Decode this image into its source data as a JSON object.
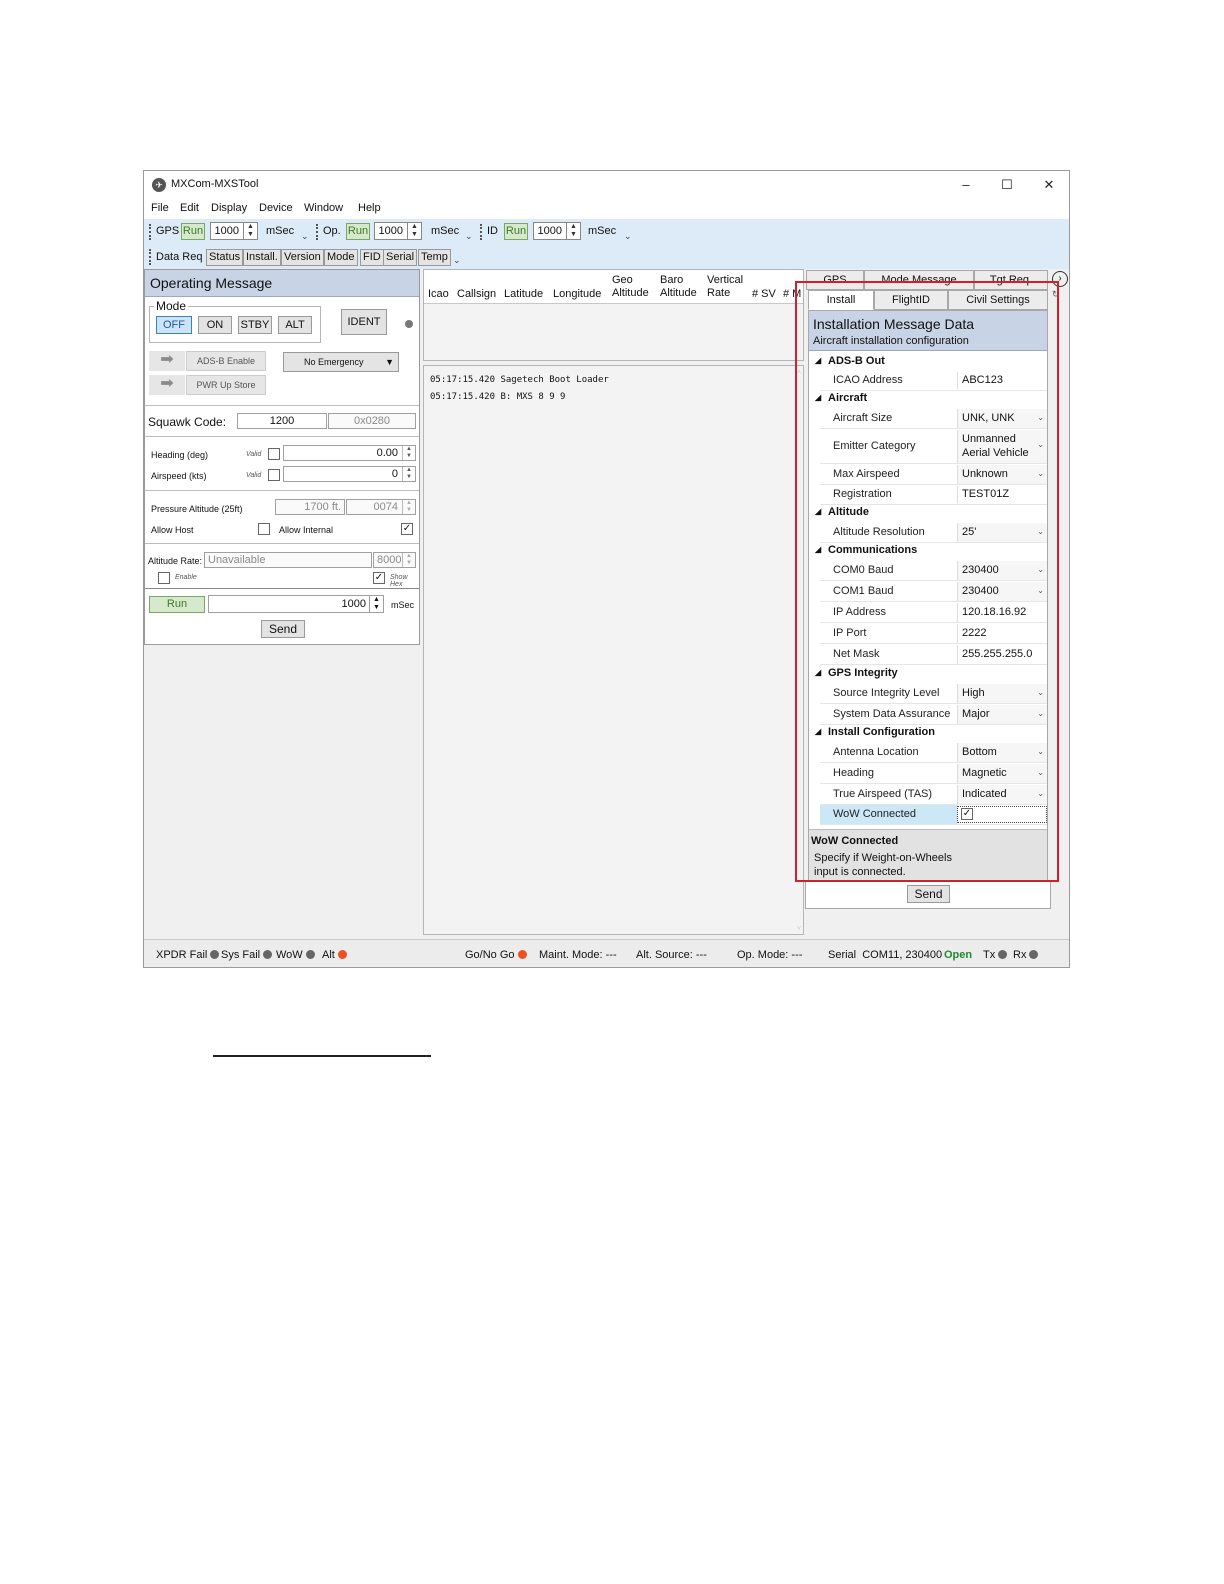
{
  "window": {
    "title": "MXCom-MXSTool",
    "minimize": "–",
    "maximize": "☐",
    "close": "✕"
  },
  "menu": [
    "File",
    "Edit",
    "Display",
    "Device",
    "Window",
    "Help"
  ],
  "toolbar1": {
    "gps_label": "GPS",
    "gps_run": "Run",
    "gps_value": "1000",
    "gps_unit": "mSec",
    "op_label": "Op.",
    "op_run": "Run",
    "op_value": "1000",
    "op_unit": "mSec",
    "id_label": "ID",
    "id_run": "Run",
    "id_value": "1000",
    "id_unit": "mSec"
  },
  "toolbar2": {
    "label": "Data Req",
    "buttons": [
      "Status",
      "Install.",
      "Version",
      "Mode",
      "FID",
      "Serial",
      "Temp"
    ]
  },
  "operating": {
    "title": "Operating Message",
    "mode_label": "Mode",
    "modes": [
      "OFF",
      "ON",
      "STBY",
      "ALT"
    ],
    "ident": "IDENT",
    "adsb_enable": "ADS-B Enable",
    "pwr_up_store": "PWR Up Store",
    "emergency": "No Emergency",
    "squawk_label": "Squawk Code:",
    "squawk_value": "1200",
    "squawk_hex": "0x0280",
    "heading_label": "Heading (deg)",
    "heading_valid": "Valid",
    "heading_value": "0.00",
    "airspeed_label": "Airspeed (kts)",
    "airspeed_valid": "Valid",
    "airspeed_value": "0",
    "pressure_label": "Pressure Altitude (25ft)",
    "pressure_value": "1700 ft.",
    "pressure_hex": "0074",
    "allow_host": "Allow Host",
    "allow_internal": "Allow Internal",
    "altrate_label": "Altitude Rate:",
    "altrate_value": "Unavailable",
    "altrate_num": "8000",
    "enable": "Enable",
    "show_hex": "Show Hex",
    "run": "Run",
    "run_value": "1000",
    "run_unit": "mSec",
    "send": "Send"
  },
  "target_table": {
    "columns": [
      "Icao",
      "Callsign",
      "Latitude",
      "Longitude",
      "Geo\nAltitude",
      "Baro\nAltitude",
      "Vertical\nRate",
      "# SV",
      "# M"
    ]
  },
  "log": [
    "05:17:15.420 Sagetech Boot Loader",
    "05:17:15.420 B: MXS 8 9 9"
  ],
  "right_panel": {
    "tabs_back": [
      "GPS",
      "Mode Message",
      "Tgt Req."
    ],
    "tabs_front": [
      "Install",
      "FlightID",
      "Civil Settings"
    ],
    "title": "Installation Message Data",
    "subtitle": "Aircraft installation configuration",
    "categories": {
      "adsb": "ADS-B Out",
      "aircraft": "Aircraft",
      "altitude": "Altitude",
      "comms": "Communications",
      "gps": "GPS Integrity",
      "install": "Install Configuration"
    },
    "props": {
      "icao_name": "ICAO Address",
      "icao_val": "ABC123",
      "size_name": "Aircraft Size",
      "size_val": "UNK, UNK",
      "emitter_name": "Emitter Category",
      "emitter_val1": "Unmanned",
      "emitter_val2": "Aerial Vehicle",
      "maxspd_name": "Max Airspeed",
      "maxspd_val": "Unknown",
      "reg_name": "Registration",
      "reg_val": "TEST01Z",
      "altres_name": "Altitude Resolution",
      "altres_val": "25'",
      "com0_name": "COM0 Baud",
      "com0_val": "230400",
      "com1_name": "COM1 Baud",
      "com1_val": "230400",
      "ip_name": "IP Address",
      "ip_val": "120.18.16.92",
      "port_name": "IP Port",
      "port_val": "2222",
      "mask_name": "Net Mask",
      "mask_val": "255.255.255.0",
      "sil_name": "Source Integrity Level",
      "sil_val": "High",
      "sda_name": "System Data Assurance",
      "sda_val": "Major",
      "ant_name": "Antenna Location",
      "ant_val": "Bottom",
      "hdg_name": "Heading",
      "hdg_val": "Magnetic",
      "tas_name": "True Airspeed (TAS)",
      "tas_val": "Indicated",
      "wow_name": "WoW Connected"
    },
    "desc_title": "WoW Connected",
    "desc_text1": "Specify if Weight-on-Wheels",
    "desc_text2": "input is connected.",
    "send": "Send"
  },
  "status_bar": {
    "xpdr": "XPDR Fail",
    "sys": "Sys Fail",
    "wow": "WoW",
    "alt": "Alt",
    "gonogo": "Go/No Go",
    "maint": "Maint. Mode: ---",
    "altsrc": "Alt. Source: ---",
    "opmode": "Op. Mode: ---",
    "serial": "Serial  COM11, 230400",
    "open": "Open",
    "tx": "Tx",
    "rx": "Rx"
  },
  "colors": {
    "accent_header": "#c8d3e6",
    "toolbar_bg": "#ddeaf7",
    "alert_orange": "#f0501e",
    "ok_green": "#1e8c2e",
    "highlight_red": "#d0202a"
  }
}
